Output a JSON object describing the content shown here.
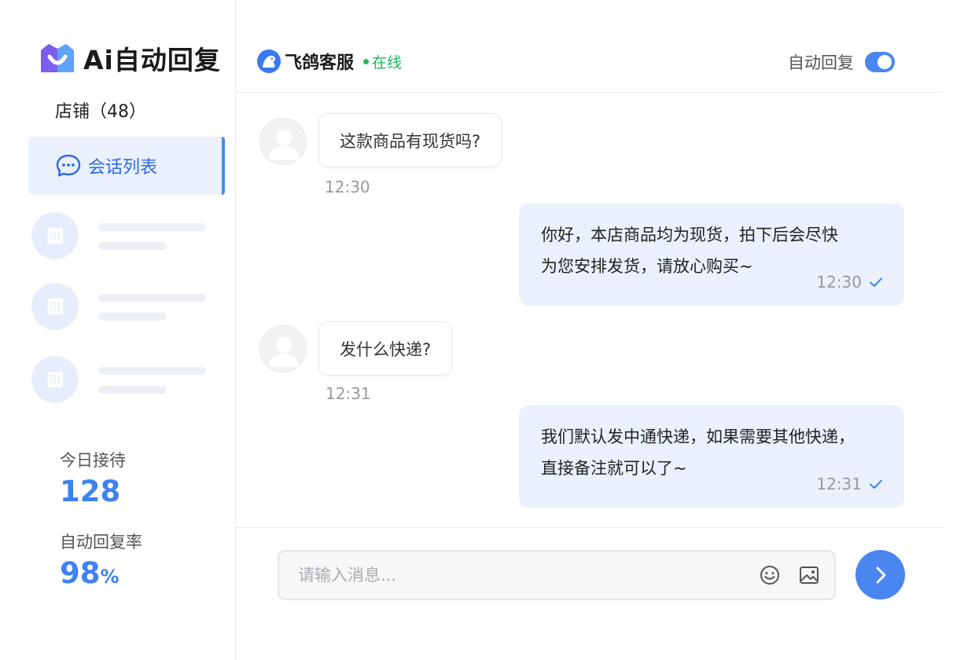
{
  "brand": {
    "title": "Ai自动回复"
  },
  "sidebar": {
    "store_label": "店铺（48）",
    "nav_active_label": "会话列表",
    "stats": [
      {
        "label": "今日接待",
        "value": "128",
        "unit": ""
      },
      {
        "label": "自动回复率",
        "value": "98",
        "unit": "%"
      }
    ]
  },
  "header": {
    "agent_name": "飞鸽客服",
    "status": "在线",
    "auto_reply_label": "自动回复",
    "auto_reply_on": true
  },
  "messages": [
    {
      "direction": "in",
      "text": "这款商品有现货吗?",
      "time": "12:30"
    },
    {
      "direction": "out",
      "text": "你好，本店商品均为现货，拍下后会尽快\n为您安排发货，请放心购买~",
      "time": "12:30"
    },
    {
      "direction": "in",
      "text": "发什么快递?",
      "time": "12:31"
    },
    {
      "direction": "out",
      "text": "我们默认发中通快递，如果需要其他快递，\n直接备注就可以了~",
      "time": "12:31"
    }
  ],
  "composer": {
    "placeholder": "请输入消息..."
  },
  "colors": {
    "accent": "#4a86f0",
    "online": "#1fb95b",
    "bubble_out": "#eaf1fd"
  }
}
